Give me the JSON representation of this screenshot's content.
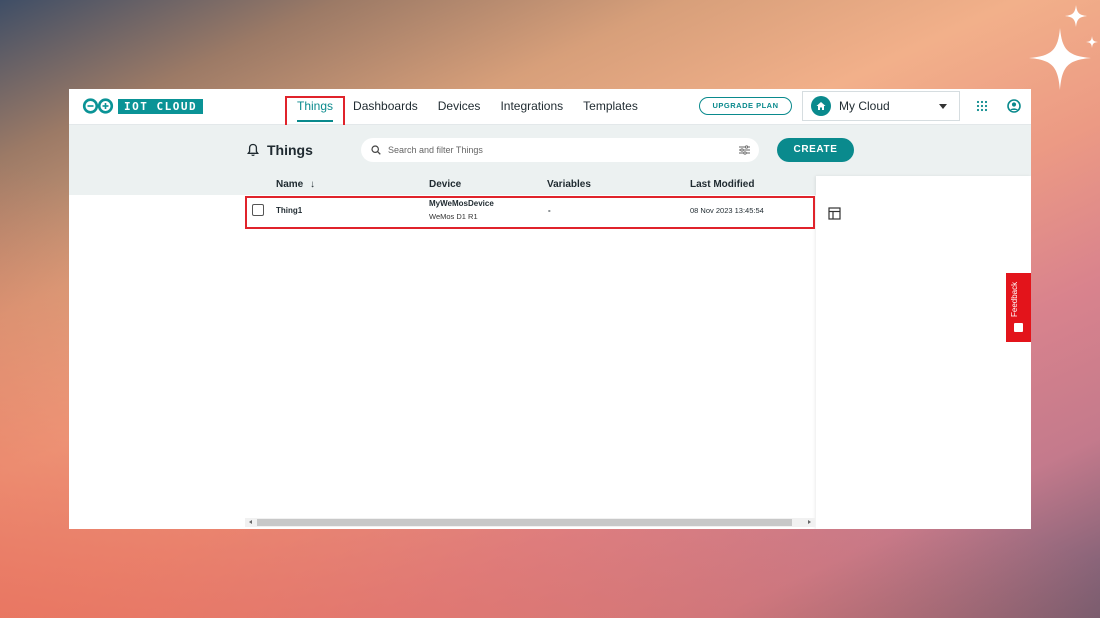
{
  "app": {
    "logo_text": "IOT CLOUD"
  },
  "nav": {
    "items": [
      {
        "label": "Things",
        "active": true
      },
      {
        "label": "Dashboards"
      },
      {
        "label": "Devices"
      },
      {
        "label": "Integrations"
      },
      {
        "label": "Templates"
      }
    ],
    "upgrade_label": "UPGRADE PLAN",
    "cloud_label": "My Cloud"
  },
  "page": {
    "title": "Things",
    "search_placeholder": "Search and filter Things",
    "create_label": "CREATE"
  },
  "table": {
    "columns": [
      "Name",
      "Device",
      "Variables",
      "Last Modified"
    ],
    "sort_indicator": "↓",
    "rows": [
      {
        "name": "Thing1",
        "device_name": "MyWeMosDevice",
        "device_type": "WeMos D1 R1",
        "variables": "-",
        "last_modified": "08 Nov 2023 13:45:54"
      }
    ]
  },
  "feedback": {
    "label": "Feedback"
  },
  "colors": {
    "accent": "#0a8a8d",
    "highlight": "#e0232b",
    "feedback": "#e3141b"
  },
  "icons": [
    "arduino-infinity-icon",
    "bell-icon",
    "search-icon",
    "filter-icon",
    "home-icon",
    "apps-grid-icon",
    "user-icon",
    "layout-icon",
    "sparkle-icon"
  ]
}
